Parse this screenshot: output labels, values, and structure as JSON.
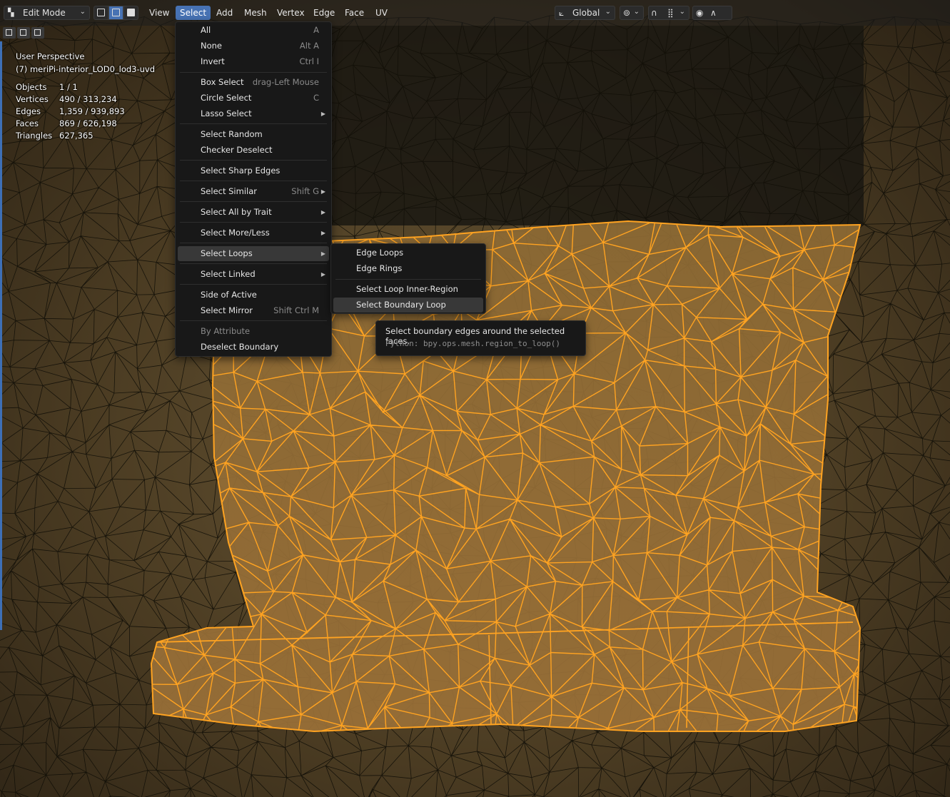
{
  "header": {
    "mode_label": "Edit Mode",
    "menus": [
      "View",
      "Select",
      "Add",
      "Mesh",
      "Vertex",
      "Edge",
      "Face",
      "UV"
    ],
    "active_menu": "Select",
    "transform_orientation": "Global",
    "accent_color": "#4772b3"
  },
  "overlay": {
    "view_name": "User Perspective",
    "object_name": "(7) meriPi-interior_LOD0_lod3-uvd"
  },
  "stats": [
    {
      "key": "Objects",
      "value": "1 / 1"
    },
    {
      "key": "Vertices",
      "value": "490 / 313,234"
    },
    {
      "key": "Edges",
      "value": "1,359 / 939,893"
    },
    {
      "key": "Faces",
      "value": "869 / 626,198"
    },
    {
      "key": "Triangles",
      "value": "627,365"
    }
  ],
  "select_menu": {
    "items": [
      {
        "label": "All",
        "shortcut": "A"
      },
      {
        "label": "None",
        "shortcut": "Alt A"
      },
      {
        "label": "Invert",
        "shortcut": "Ctrl I"
      },
      {
        "label": "Box Select",
        "shortcut": "drag-Left Mouse"
      },
      {
        "label": "Circle Select",
        "shortcut": "C"
      },
      {
        "label": "Lasso Select",
        "shortcut": ""
      },
      {
        "label": "Select Random",
        "shortcut": ""
      },
      {
        "label": "Checker Deselect",
        "shortcut": ""
      },
      {
        "label": "Select Sharp Edges",
        "shortcut": ""
      },
      {
        "label": "Select Similar",
        "shortcut": "Shift G"
      },
      {
        "label": "Select All by Trait",
        "shortcut": ""
      },
      {
        "label": "Select More/Less",
        "shortcut": ""
      },
      {
        "label": "Select Loops",
        "shortcut": ""
      },
      {
        "label": "Select Linked",
        "shortcut": ""
      },
      {
        "label": "Side of Active",
        "shortcut": ""
      },
      {
        "label": "Select Mirror",
        "shortcut": "Shift Ctrl M"
      },
      {
        "label": "By Attribute",
        "shortcut": ""
      },
      {
        "label": "Deselect Boundary",
        "shortcut": ""
      }
    ]
  },
  "loops_submenu": {
    "items": [
      {
        "label": "Edge Loops"
      },
      {
        "label": "Edge Rings"
      },
      {
        "label": "Select Loop Inner-Region"
      },
      {
        "label": "Select Boundary Loop"
      }
    ]
  },
  "tooltip": {
    "description": "Select boundary edges around the selected faces.",
    "python": "Python: bpy.ops.mesh.region_to_loop()"
  },
  "colors": {
    "selected_mesh": "#ffa321",
    "menu_bg": "#181818",
    "highlight": "#383838"
  }
}
